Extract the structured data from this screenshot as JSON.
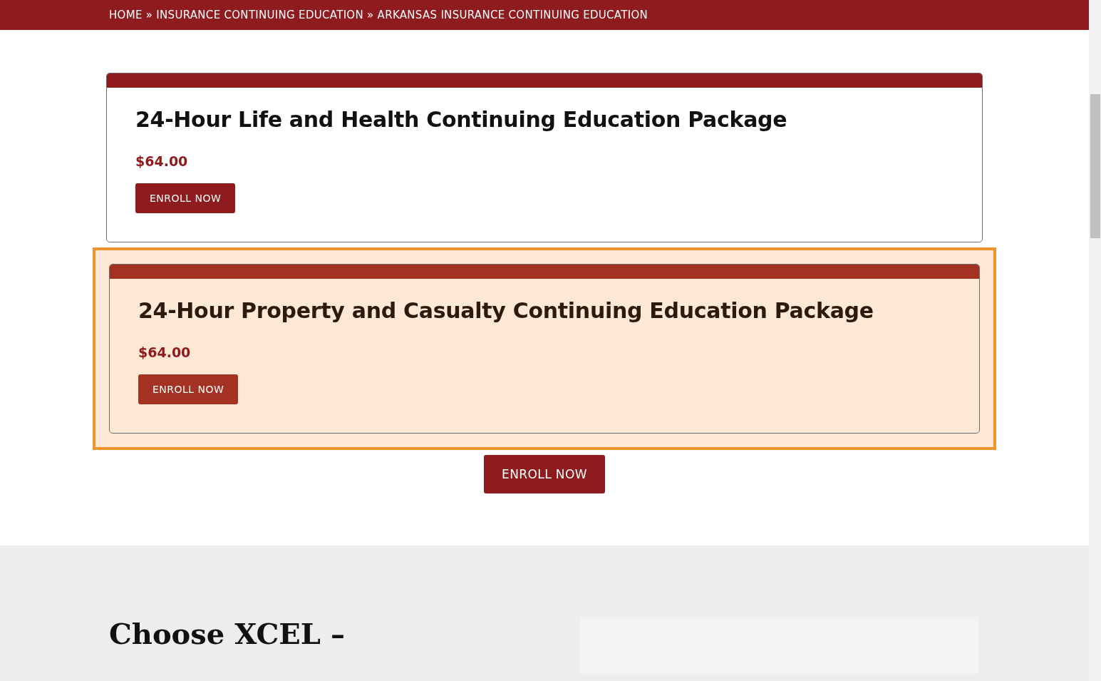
{
  "breadcrumb": "HOME » INSURANCE CONTINUING EDUCATION » ARKANSAS INSURANCE CONTINUING EDUCATION",
  "packages": [
    {
      "title": "24-Hour Life and Health Continuing Education Package",
      "price": "$64.00",
      "button": "ENROLL NOW",
      "selected": false
    },
    {
      "title": "24-Hour Property and Casualty Continuing Education Package",
      "price": "$64.00",
      "button": "ENROLL NOW",
      "selected": true
    }
  ],
  "main_button": "ENROLL NOW",
  "section_heading": "Choose XCEL –"
}
